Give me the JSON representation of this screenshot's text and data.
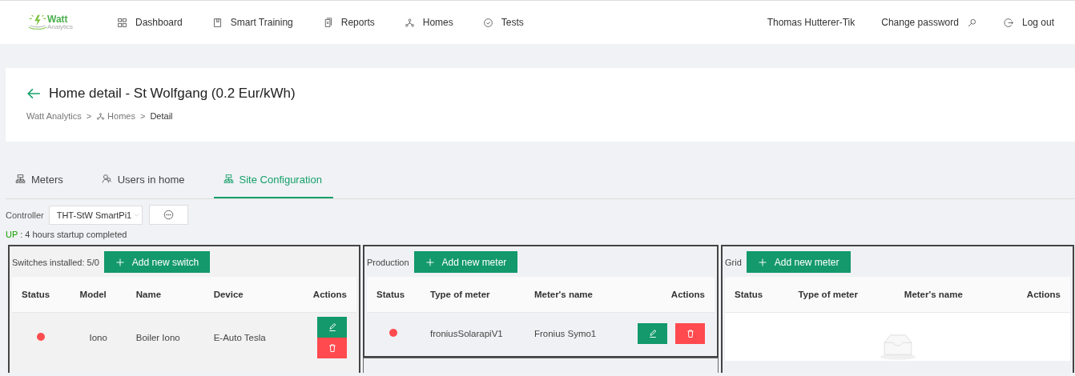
{
  "logo": {
    "name": "Watt",
    "subtitle": "Analytics"
  },
  "nav": [
    {
      "label": "Dashboard"
    },
    {
      "label": "Smart Training"
    },
    {
      "label": "Reports"
    },
    {
      "label": "Homes"
    },
    {
      "label": "Tests"
    }
  ],
  "user": {
    "name": "Thomas Hutterer-Tik",
    "change_password": "Change password",
    "logout": "Log out"
  },
  "page": {
    "title": "Home detail - St Wolfgang (0.2 Eur/kWh)",
    "breadcrumb": [
      "Watt Analytics",
      "Homes",
      "Detail"
    ],
    "separator": ">"
  },
  "tabs": [
    {
      "label": "Meters",
      "selected": false
    },
    {
      "label": "Users in home",
      "selected": false
    },
    {
      "label": "Site Configuration",
      "selected": true
    }
  ],
  "controller": {
    "label": "Controller",
    "value": "THT-StW SmartPi1"
  },
  "status_line": {
    "state": "UP",
    "text": ": 4 hours startup completed"
  },
  "panels": [
    {
      "kind": "switches",
      "title": "Switches installed: 5/0",
      "button": "Add new switch",
      "columns": [
        "Status",
        "Model",
        "Name",
        "Device",
        "Actions"
      ],
      "rows": [
        {
          "color": "#ff4d4f",
          "cells": [
            "",
            "Iono",
            "Boiler Iono",
            "E-Auto Tesla",
            ""
          ]
        }
      ]
    },
    {
      "kind": "meters",
      "title": "Production",
      "button": "Add new meter",
      "columns": [
        "Status",
        "Type of meter",
        "Meter's name",
        "Actions"
      ],
      "rows": [
        {
          "color": "#ff4d4f",
          "cells": [
            "",
            "froniusSolarapiV1",
            "Fronius Symo1",
            ""
          ]
        }
      ]
    },
    {
      "kind": "meters",
      "title": "Grid",
      "button": "Add new meter",
      "columns": [
        "Status",
        "Type of meter",
        "Meter's name",
        "Actions"
      ]
    }
  ]
}
